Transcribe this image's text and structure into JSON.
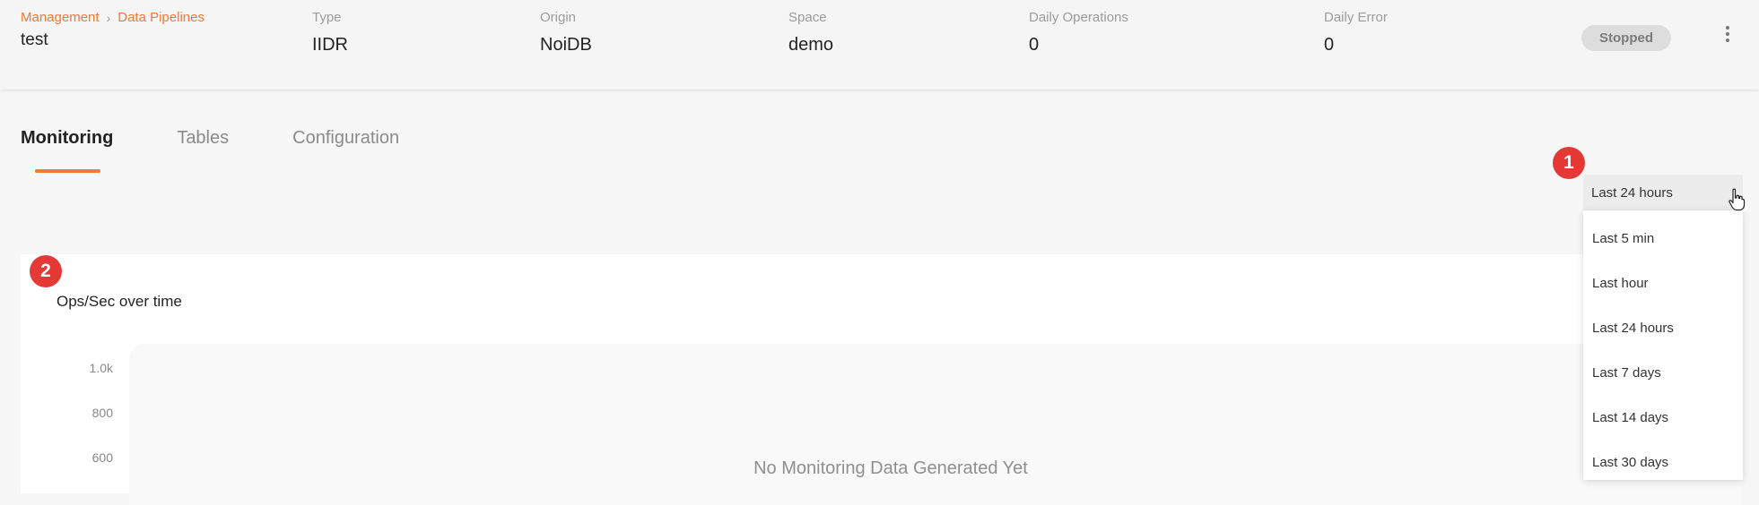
{
  "header": {
    "breadcrumb": [
      "Management",
      "Data Pipelines"
    ],
    "pipeline_name": "test",
    "fields": [
      {
        "label": "Type",
        "value": "IIDR"
      },
      {
        "label": "Origin",
        "value": "NoiDB"
      },
      {
        "label": "Space",
        "value": "demo"
      },
      {
        "label": "Daily Operations",
        "value": "0"
      },
      {
        "label": "Daily Error",
        "value": "0"
      }
    ],
    "status": "Stopped",
    "menu_icon": "kebab-menu-icon"
  },
  "tabs": [
    "Monitoring",
    "Tables",
    "Configuration"
  ],
  "active_tab": "Monitoring",
  "time_range": {
    "selected": "Last 24 hours",
    "options": [
      "Last 5 min",
      "Last hour",
      "Last 24 hours",
      "Last 7 days",
      "Last 14 days",
      "Last 30 days"
    ]
  },
  "markers": [
    "1",
    "2"
  ],
  "chart": {
    "title": "Ops/Sec over time",
    "y_ticks": [
      "1.0k",
      "800",
      "600"
    ],
    "empty_message": "No Monitoring Data Generated Yet"
  },
  "colors": {
    "accent": "#f07a36",
    "marker": "#e53935",
    "status_bg": "#dddddd"
  }
}
